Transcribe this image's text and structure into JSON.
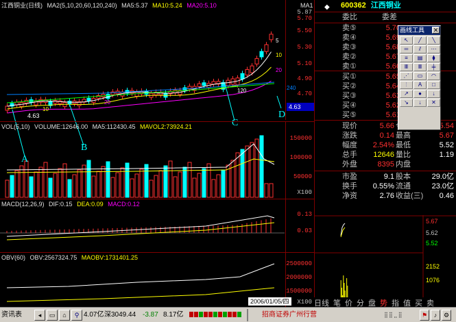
{
  "main_header": {
    "name": "江西铜业(日线)",
    "ma_params": "MA2(5,10,20,60,120,240)",
    "ma5": "MA5:5.37",
    "ma10": "MA10:5.24",
    "ma20": "MA20:5.10",
    "ma_label_right": "MA1"
  },
  "price_axis": [
    "5.87",
    "5.70",
    "5.50",
    "5.30",
    "5.10",
    "4.90",
    "4.70"
  ],
  "current_price_tag": "4.63",
  "low_marker": "4.63",
  "ma_tags": [
    "5",
    "10",
    "20",
    "120",
    "240",
    "10",
    "20"
  ],
  "annotations": [
    "A",
    "B",
    "C",
    "D"
  ],
  "volume_header": {
    "vol": "VOL(5,10)",
    "volume": "VOLUME:12646.00",
    "ma5": "MA5:112430.45",
    "mavol2": "MAVOL2:73924.21"
  },
  "volume_axis": [
    "150000",
    "100000",
    "50000",
    "X100"
  ],
  "macd_header": {
    "macd": "MACD(12,26,9)",
    "dif": "DIF:0.15",
    "dea": "DEA:0.09",
    "macd_val": "MACD:0.12"
  },
  "macd_axis": [
    "0.13",
    "0.03"
  ],
  "obv_header": {
    "obv": "OBV(60)",
    "obv_val": "OBV:2567324.75",
    "maobv": "MAOBV:1731401.25"
  },
  "obv_axis": [
    "2500000",
    "2000000",
    "1500000",
    "X100"
  ],
  "date_tag": "2006/01/05/四",
  "stock": {
    "code": "600362",
    "name": "江西铜业"
  },
  "order_header": {
    "left": "委比",
    "right": "委差"
  },
  "sell": [
    {
      "label": "卖⑤",
      "price": "5.70",
      "vol": ""
    },
    {
      "label": "卖④",
      "price": "5.69",
      "vol": ""
    },
    {
      "label": "卖③",
      "price": "5.68",
      "vol": ""
    },
    {
      "label": "卖②",
      "price": "5.67",
      "vol": ""
    },
    {
      "label": "卖①",
      "price": "5.66",
      "vol": ""
    }
  ],
  "buy": [
    {
      "label": "买①",
      "price": "5.65",
      "vol": ""
    },
    {
      "label": "买②",
      "price": "5.64",
      "vol": ""
    },
    {
      "label": "买③",
      "price": "5.63",
      "vol": ""
    },
    {
      "label": "买④",
      "price": "5.62",
      "vol": ""
    },
    {
      "label": "买⑤",
      "price": "5.61",
      "vol": ""
    }
  ],
  "stats": [
    {
      "k1": "现价",
      "v1": "5.66",
      "c1": "#ff3030",
      "k2": "今开",
      "v2": "5.54",
      "c2": "#ff3030"
    },
    {
      "k1": "涨跌",
      "v1": "0.14",
      "c1": "#ff3030",
      "k2": "最高",
      "v2": "5.67",
      "c2": "#ff3030"
    },
    {
      "k1": "幅度",
      "v1": "2.54%",
      "c1": "#ff3030",
      "k2": "最低",
      "v2": "5.52",
      "c2": "#ffffff"
    },
    {
      "k1": "总手",
      "v1": "12646",
      "c1": "#ffff00",
      "k2": "量比",
      "v2": "1.19",
      "c2": "#ffffff"
    },
    {
      "k1": "外盘",
      "v1": "8395",
      "c1": "#ff3030",
      "k2": "内盘",
      "v2": "",
      "c2": "#00ff00"
    },
    {
      "k1": "市盈",
      "v1": "9.1",
      "c1": "#ffffff",
      "k2": "股本",
      "v2": "29.0亿",
      "c2": "#ffffff"
    },
    {
      "k1": "换手",
      "v1": "0.55%",
      "c1": "#ffffff",
      "k2": "流通",
      "v2": "23.0亿",
      "c2": "#ffffff"
    },
    {
      "k1": "净资",
      "v1": "2.76",
      "c1": "#ffffff",
      "k2": "收益(三)",
      "v2": "0.46",
      "c2": "#ffffff"
    }
  ],
  "toolbox": {
    "title": "画线工具",
    "close": "✕",
    "buttons": [
      "↖",
      "╱",
      "╲",
      "═",
      "⫽",
      "⋯",
      "≡",
      "▤",
      "⧫",
      "Ⅲ",
      "Ⅲ",
      "╪",
      "⋰",
      "▭",
      "◠",
      "⫶",
      "A",
      "□",
      "↗",
      "●",
      "↓",
      "↘",
      "↓",
      "✕"
    ]
  },
  "mini_axis": [
    "5.67",
    "5.62",
    "5.52",
    "2152",
    "1076"
  ],
  "bottom_tabs": [
    "日线",
    "笔",
    "价",
    "分",
    "盘",
    "势",
    "指",
    "值",
    "买",
    "卖"
  ],
  "bottom_tab_active": "势",
  "status_bar": {
    "left": "资讯表",
    "market": "4.07亿",
    "sz_label": "深3049.44",
    "sz_change": "-3.87",
    "sz_amount": "8.17亿",
    "broker": "招商证券广州行营"
  },
  "colors": {
    "up": "#ff3030",
    "down": "#00ffff",
    "ma5": "#ffffff",
    "ma10": "#ffff00",
    "ma20": "#ff00ff",
    "ma120": "#00ff00",
    "ma240": "#0080ff",
    "grid": "#800000"
  }
}
